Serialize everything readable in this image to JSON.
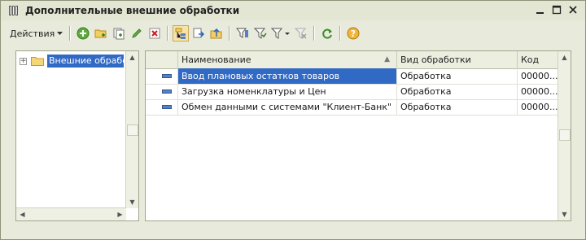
{
  "window": {
    "title": "Дополнительные внешние обработки",
    "buttons": [
      "minimize",
      "maximize",
      "close"
    ]
  },
  "toolbar": {
    "actions_label": "Действия",
    "icons": [
      "add-icon",
      "add-folder-icon",
      "copy-icon",
      "edit-icon",
      "delete-icon",
      "hierarchy-icon",
      "move-to-folder-icon",
      "up-level-icon",
      "filter-icon",
      "filter-set-icon",
      "filter-menu-icon",
      "filter-clear-icon",
      "refresh-icon",
      "help-icon"
    ]
  },
  "tree": {
    "items": [
      {
        "label": "Внешние обработ",
        "expanded": false,
        "selected": true
      }
    ]
  },
  "grid": {
    "columns": [
      "",
      "Наименование",
      "Вид обработки",
      "Код"
    ],
    "rows": [
      {
        "name": "Ввод плановых остатков товаров",
        "type": "Обработка",
        "code": "00000...",
        "selected": true
      },
      {
        "name": "Загрузка номенклатуры и Цен",
        "type": "Обработка",
        "code": "00000...",
        "selected": false
      },
      {
        "name": "Обмен данными с системами \"Клиент-Банк\"",
        "type": "Обработка",
        "code": "00000...",
        "selected": false
      }
    ]
  },
  "colors": {
    "selection": "#316ac5",
    "background": "#e8ebdb"
  }
}
